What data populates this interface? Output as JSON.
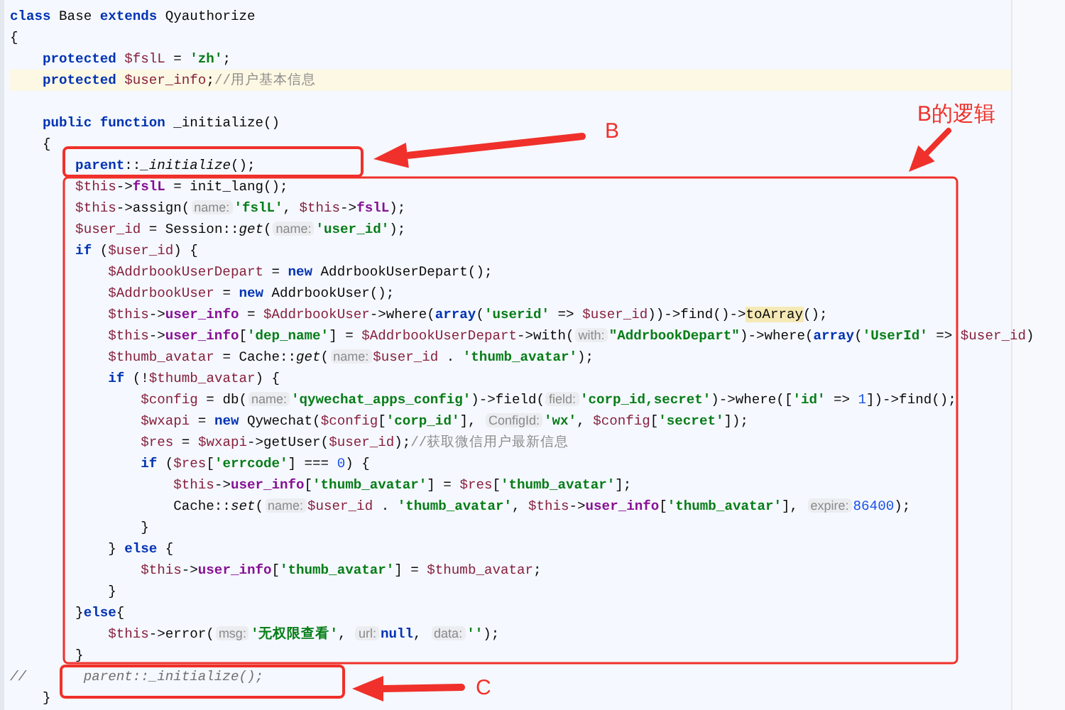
{
  "editor": {
    "lines": [
      {
        "current": false,
        "tokens": [
          {
            "kind": "keyword",
            "text": "class"
          },
          {
            "kind": "plain",
            "text": " Base "
          },
          {
            "kind": "keyword",
            "text": "extends"
          },
          {
            "kind": "plain",
            "text": " Qyauthorize"
          }
        ]
      },
      {
        "current": false,
        "tokens": [
          {
            "kind": "plain",
            "text": "{"
          }
        ]
      },
      {
        "current": false,
        "tokens": [
          {
            "kind": "keyword",
            "text": "    protected"
          },
          {
            "kind": "variable",
            "text": " $fslL"
          },
          {
            "kind": "plain",
            "text": " = "
          },
          {
            "kind": "string",
            "text": "'zh'"
          },
          {
            "kind": "plain",
            "text": ";"
          }
        ]
      },
      {
        "current": true,
        "tokens": [
          {
            "kind": "keyword",
            "text": "    protected"
          },
          {
            "kind": "variable",
            "text": " $user_info"
          },
          {
            "kind": "plain",
            "text": ";"
          },
          {
            "kind": "comment",
            "text": "//用户基本信息"
          }
        ]
      },
      {
        "current": false
      },
      {
        "current": false,
        "tokens": [
          {
            "kind": "keyword",
            "text": "    public function"
          },
          {
            "kind": "plain",
            "text": " _initialize()"
          }
        ]
      },
      {
        "current": false,
        "tokens": [
          {
            "kind": "plain",
            "text": "    {"
          }
        ]
      },
      {
        "current": false,
        "tokens": [
          {
            "kind": "keyword",
            "text": "        parent"
          },
          {
            "kind": "plain",
            "text": "::"
          },
          {
            "kind": "italic",
            "text": "_initialize"
          },
          {
            "kind": "plain",
            "text": "();"
          }
        ]
      },
      {
        "current": false,
        "tokens": [
          {
            "kind": "variable",
            "text": "        $this"
          },
          {
            "kind": "plain",
            "text": "->"
          },
          {
            "kind": "field",
            "text": "fslL"
          },
          {
            "kind": "plain",
            "text": " = init_lang();"
          }
        ]
      },
      {
        "current": false,
        "tokens": [
          {
            "kind": "variable",
            "text": "        $this"
          },
          {
            "kind": "plain",
            "text": "->assign("
          },
          {
            "kind": "hint",
            "text": "name:"
          },
          {
            "kind": "string",
            "text": "'fslL'"
          },
          {
            "kind": "plain",
            "text": ", "
          },
          {
            "kind": "variable",
            "text": "$this"
          },
          {
            "kind": "plain",
            "text": "->"
          },
          {
            "kind": "field",
            "text": "fslL"
          },
          {
            "kind": "plain",
            "text": ");"
          }
        ]
      },
      {
        "current": false,
        "tokens": [
          {
            "kind": "variable",
            "text": "        $user_id"
          },
          {
            "kind": "plain",
            "text": " = Session::"
          },
          {
            "kind": "italic",
            "text": "get"
          },
          {
            "kind": "plain",
            "text": "("
          },
          {
            "kind": "hint",
            "text": "name:"
          },
          {
            "kind": "string",
            "text": "'user_id'"
          },
          {
            "kind": "plain",
            "text": ");"
          }
        ]
      },
      {
        "current": false,
        "tokens": [
          {
            "kind": "keyword",
            "text": "        if"
          },
          {
            "kind": "plain",
            "text": " ("
          },
          {
            "kind": "variable",
            "text": "$user_id"
          },
          {
            "kind": "plain",
            "text": ") {"
          }
        ]
      },
      {
        "current": false,
        "tokens": [
          {
            "kind": "variable",
            "text": "            $AddrbookUserDepart"
          },
          {
            "kind": "plain",
            "text": " = "
          },
          {
            "kind": "keyword",
            "text": "new"
          },
          {
            "kind": "plain",
            "text": " AddrbookUserDepart();"
          }
        ]
      },
      {
        "current": false,
        "tokens": [
          {
            "kind": "variable",
            "text": "            $AddrbookUser"
          },
          {
            "kind": "plain",
            "text": " = "
          },
          {
            "kind": "keyword",
            "text": "new"
          },
          {
            "kind": "plain",
            "text": " AddrbookUser();"
          }
        ]
      },
      {
        "current": false,
        "tokens": [
          {
            "kind": "variable",
            "text": "            $this"
          },
          {
            "kind": "plain",
            "text": "->"
          },
          {
            "kind": "field",
            "text": "user_info"
          },
          {
            "kind": "plain",
            "text": " = "
          },
          {
            "kind": "variable",
            "text": "$AddrbookUser"
          },
          {
            "kind": "plain",
            "text": "->where("
          },
          {
            "kind": "keyword",
            "text": "array"
          },
          {
            "kind": "plain",
            "text": "("
          },
          {
            "kind": "string",
            "text": "'userid'"
          },
          {
            "kind": "plain",
            "text": " => "
          },
          {
            "kind": "variable",
            "text": "$user_id"
          },
          {
            "kind": "plain",
            "text": "))->find()->"
          },
          {
            "kind": "match",
            "text": "toArray"
          },
          {
            "kind": "plain",
            "text": "();"
          }
        ]
      },
      {
        "current": false,
        "tokens": [
          {
            "kind": "variable",
            "text": "            $this"
          },
          {
            "kind": "plain",
            "text": "->"
          },
          {
            "kind": "field",
            "text": "user_info"
          },
          {
            "kind": "plain",
            "text": "["
          },
          {
            "kind": "string",
            "text": "'dep_name'"
          },
          {
            "kind": "plain",
            "text": "] = "
          },
          {
            "kind": "variable",
            "text": "$AddrbookUserDepart"
          },
          {
            "kind": "plain",
            "text": "->with("
          },
          {
            "kind": "hint",
            "text": "with:"
          },
          {
            "kind": "string",
            "text": "\"AddrbookDepart\""
          },
          {
            "kind": "plain",
            "text": ")->where("
          },
          {
            "kind": "keyword",
            "text": "array"
          },
          {
            "kind": "plain",
            "text": "("
          },
          {
            "kind": "string",
            "text": "'UserId'"
          },
          {
            "kind": "plain",
            "text": " => "
          },
          {
            "kind": "variable",
            "text": "$user_id"
          },
          {
            "kind": "plain",
            "text": ")"
          }
        ]
      },
      {
        "current": false,
        "tokens": [
          {
            "kind": "variable",
            "text": "            $thumb_avatar"
          },
          {
            "kind": "plain",
            "text": " = Cache::"
          },
          {
            "kind": "italic",
            "text": "get"
          },
          {
            "kind": "plain",
            "text": "("
          },
          {
            "kind": "hint",
            "text": "name:"
          },
          {
            "kind": "variable",
            "text": "$user_id"
          },
          {
            "kind": "plain",
            "text": " . "
          },
          {
            "kind": "string",
            "text": "'thumb_avatar'"
          },
          {
            "kind": "plain",
            "text": ");"
          }
        ]
      },
      {
        "current": false,
        "tokens": [
          {
            "kind": "keyword",
            "text": "            if"
          },
          {
            "kind": "plain",
            "text": " (!"
          },
          {
            "kind": "variable",
            "text": "$thumb_avatar"
          },
          {
            "kind": "plain",
            "text": ") {"
          }
        ]
      },
      {
        "current": false,
        "tokens": [
          {
            "kind": "variable",
            "text": "                $config"
          },
          {
            "kind": "plain",
            "text": " = db("
          },
          {
            "kind": "hint",
            "text": "name:"
          },
          {
            "kind": "string",
            "text": "'qywechat_apps_config'"
          },
          {
            "kind": "plain",
            "text": ")->field("
          },
          {
            "kind": "hint",
            "text": "field:"
          },
          {
            "kind": "string",
            "text": "'corp_id,secret'"
          },
          {
            "kind": "plain",
            "text": ")->where(["
          },
          {
            "kind": "string",
            "text": "'id'"
          },
          {
            "kind": "plain",
            "text": " => "
          },
          {
            "kind": "number",
            "text": "1"
          },
          {
            "kind": "plain",
            "text": "])->find();"
          }
        ]
      },
      {
        "current": false,
        "tokens": [
          {
            "kind": "variable",
            "text": "                $wxapi"
          },
          {
            "kind": "plain",
            "text": " = "
          },
          {
            "kind": "keyword",
            "text": "new"
          },
          {
            "kind": "plain",
            "text": " Qywechat("
          },
          {
            "kind": "variable",
            "text": "$config"
          },
          {
            "kind": "plain",
            "text": "["
          },
          {
            "kind": "string",
            "text": "'corp_id'"
          },
          {
            "kind": "plain",
            "text": "], "
          },
          {
            "kind": "hint",
            "text": "ConfigId:"
          },
          {
            "kind": "string",
            "text": "'wx'"
          },
          {
            "kind": "plain",
            "text": ", "
          },
          {
            "kind": "variable",
            "text": "$config"
          },
          {
            "kind": "plain",
            "text": "["
          },
          {
            "kind": "string",
            "text": "'secret'"
          },
          {
            "kind": "plain",
            "text": "]);"
          }
        ]
      },
      {
        "current": false,
        "tokens": [
          {
            "kind": "variable",
            "text": "                $res"
          },
          {
            "kind": "plain",
            "text": " = "
          },
          {
            "kind": "variable",
            "text": "$wxapi"
          },
          {
            "kind": "plain",
            "text": "->getUser("
          },
          {
            "kind": "variable",
            "text": "$user_id"
          },
          {
            "kind": "plain",
            "text": ");"
          },
          {
            "kind": "comment",
            "text": "//获取微信用户最新信息"
          }
        ]
      },
      {
        "current": false,
        "tokens": [
          {
            "kind": "keyword",
            "text": "                if"
          },
          {
            "kind": "plain",
            "text": " ("
          },
          {
            "kind": "variable",
            "text": "$res"
          },
          {
            "kind": "plain",
            "text": "["
          },
          {
            "kind": "string",
            "text": "'errcode'"
          },
          {
            "kind": "plain",
            "text": "] === "
          },
          {
            "kind": "number",
            "text": "0"
          },
          {
            "kind": "plain",
            "text": ") {"
          }
        ]
      },
      {
        "current": false,
        "tokens": [
          {
            "kind": "variable",
            "text": "                    $this"
          },
          {
            "kind": "plain",
            "text": "->"
          },
          {
            "kind": "field",
            "text": "user_info"
          },
          {
            "kind": "plain",
            "text": "["
          },
          {
            "kind": "string",
            "text": "'thumb_avatar'"
          },
          {
            "kind": "plain",
            "text": "] = "
          },
          {
            "kind": "variable",
            "text": "$res"
          },
          {
            "kind": "plain",
            "text": "["
          },
          {
            "kind": "string",
            "text": "'thumb_avatar'"
          },
          {
            "kind": "plain",
            "text": "];"
          }
        ]
      },
      {
        "current": false,
        "tokens": [
          {
            "kind": "plain",
            "text": "                    Cache::"
          },
          {
            "kind": "italic",
            "text": "set"
          },
          {
            "kind": "plain",
            "text": "("
          },
          {
            "kind": "hint",
            "text": "name:"
          },
          {
            "kind": "variable",
            "text": "$user_id"
          },
          {
            "kind": "plain",
            "text": " . "
          },
          {
            "kind": "string",
            "text": "'thumb_avatar'"
          },
          {
            "kind": "plain",
            "text": ", "
          },
          {
            "kind": "variable",
            "text": "$this"
          },
          {
            "kind": "plain",
            "text": "->"
          },
          {
            "kind": "field",
            "text": "user_info"
          },
          {
            "kind": "plain",
            "text": "["
          },
          {
            "kind": "string",
            "text": "'thumb_avatar'"
          },
          {
            "kind": "plain",
            "text": "], "
          },
          {
            "kind": "hint",
            "text": "expire:"
          },
          {
            "kind": "number",
            "text": "86400"
          },
          {
            "kind": "plain",
            "text": ");"
          }
        ]
      },
      {
        "current": false,
        "tokens": [
          {
            "kind": "plain",
            "text": "                }"
          }
        ]
      },
      {
        "current": false,
        "tokens": [
          {
            "kind": "plain",
            "text": "            } "
          },
          {
            "kind": "keyword",
            "text": "else"
          },
          {
            "kind": "plain",
            "text": " {"
          }
        ]
      },
      {
        "current": false,
        "tokens": [
          {
            "kind": "variable",
            "text": "                $this"
          },
          {
            "kind": "plain",
            "text": "->"
          },
          {
            "kind": "field",
            "text": "user_info"
          },
          {
            "kind": "plain",
            "text": "["
          },
          {
            "kind": "string",
            "text": "'thumb_avatar'"
          },
          {
            "kind": "plain",
            "text": "] = "
          },
          {
            "kind": "variable",
            "text": "$thumb_avatar"
          },
          {
            "kind": "plain",
            "text": ";"
          }
        ]
      },
      {
        "current": false,
        "tokens": [
          {
            "kind": "plain",
            "text": "            }"
          }
        ]
      },
      {
        "current": false,
        "tokens": [
          {
            "kind": "plain",
            "text": "        }"
          },
          {
            "kind": "keyword",
            "text": "else"
          },
          {
            "kind": "plain",
            "text": "{"
          }
        ]
      },
      {
        "current": false,
        "tokens": [
          {
            "kind": "variable",
            "text": "            $this"
          },
          {
            "kind": "plain",
            "text": "->error("
          },
          {
            "kind": "hint",
            "text": "msg:"
          },
          {
            "kind": "string",
            "text": "'无权限查看'"
          },
          {
            "kind": "plain",
            "text": ", "
          },
          {
            "kind": "hint",
            "text": "url:"
          },
          {
            "kind": "keyword",
            "text": "null"
          },
          {
            "kind": "plain",
            "text": ", "
          },
          {
            "kind": "hint",
            "text": "data:"
          },
          {
            "kind": "string",
            "text": "''"
          },
          {
            "kind": "plain",
            "text": ");"
          }
        ]
      },
      {
        "current": false,
        "tokens": [
          {
            "kind": "plain",
            "text": "        }"
          }
        ]
      },
      {
        "current": false,
        "tokens": [
          {
            "kind": "disabled",
            "text": "//       parent::_initialize();"
          }
        ]
      },
      {
        "current": false,
        "tokens": [
          {
            "kind": "plain",
            "text": "    }"
          }
        ]
      }
    ]
  },
  "annotations": [
    {
      "label": "B"
    },
    {
      "label": "B的逻辑"
    },
    {
      "label": "C"
    }
  ]
}
